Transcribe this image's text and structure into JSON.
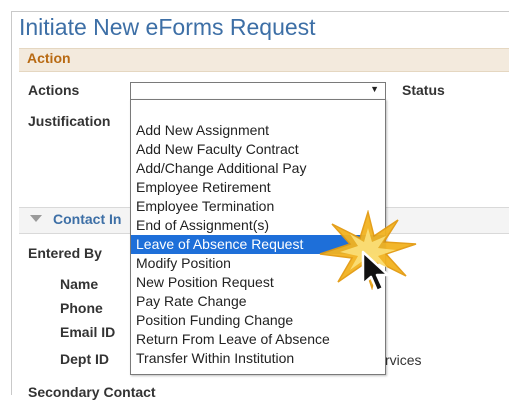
{
  "page": {
    "title": "Initiate New eForms Request"
  },
  "action_section": {
    "label": "Action"
  },
  "form": {
    "actions_label": "Actions",
    "status_label": "Status",
    "justification_label": "Justification",
    "actions_value": ""
  },
  "dropdown": {
    "options": [
      "Add New Assignment",
      "Add New Faculty Contract",
      "Add/Change Additional Pay",
      "Employee Retirement",
      "Employee Termination",
      "End of Assignment(s)",
      "Leave of Absence Request",
      "Modify Position",
      "New Position Request",
      "Pay Rate Change",
      "Position Funding Change",
      "Return From Leave of Absence",
      "Transfer Within Institution"
    ],
    "selected": "Leave of Absence Request"
  },
  "contact": {
    "header": "Contact In",
    "entered_by": "Entered By",
    "name": "Name",
    "phone": "Phone",
    "email": "Email ID",
    "dept": "Dept ID",
    "services_partial": "rvices",
    "secondary": "Secondary Contact"
  },
  "colors": {
    "title": "#3d6fa6",
    "section_label": "#b86a13",
    "section_bar": "#f3eadd",
    "highlight": "#1e6fd9",
    "burst": "#f2b320"
  },
  "icons": {
    "select_arrow": "dropdown-arrow-icon",
    "collapse": "collapse-triangle-icon",
    "cursor": "mouse-pointer-icon",
    "burst": "starburst-highlight-icon"
  }
}
